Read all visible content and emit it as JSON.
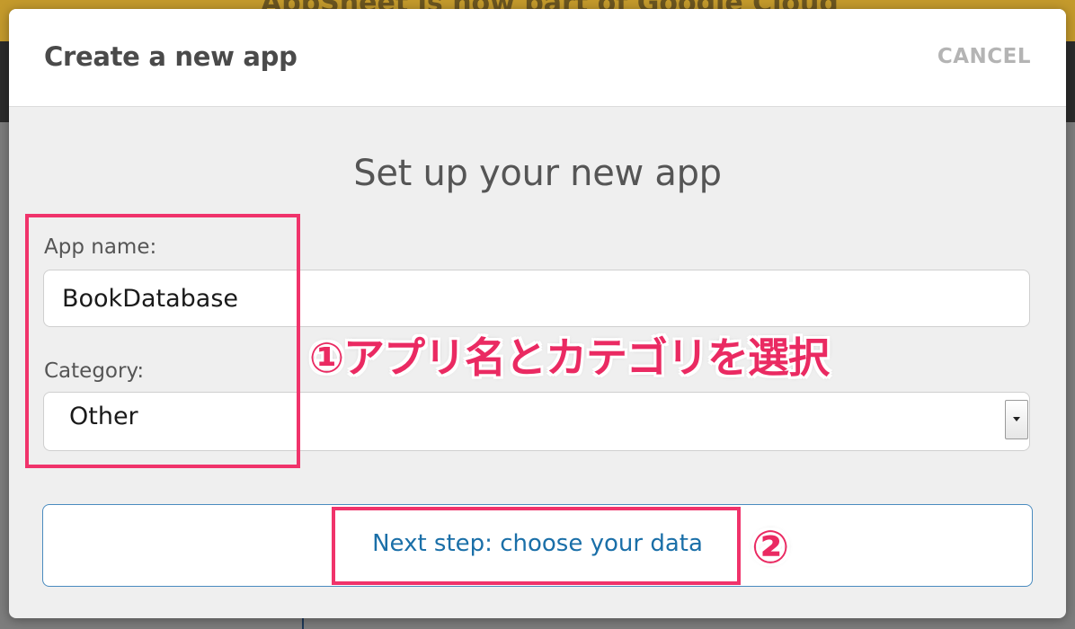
{
  "backdrop": {
    "banner_text": "AppSheet is now part of Google Cloud"
  },
  "modal": {
    "title": "Create a new app",
    "cancel_label": "CANCEL",
    "heading": "Set up your new app",
    "app_name": {
      "label": "App name:",
      "value": "BookDatabase"
    },
    "category": {
      "label": "Category:",
      "selected": "Other"
    },
    "next_button_label": "Next step: choose your data"
  },
  "annotations": {
    "step1_text": "①アプリ名とカテゴリを選択",
    "step2_text": "②",
    "color": "#f0336b"
  },
  "colors": {
    "link_blue": "#1a6fa8",
    "title_gray": "#4a4a4a",
    "cancel_gray": "#b4b4b4"
  }
}
